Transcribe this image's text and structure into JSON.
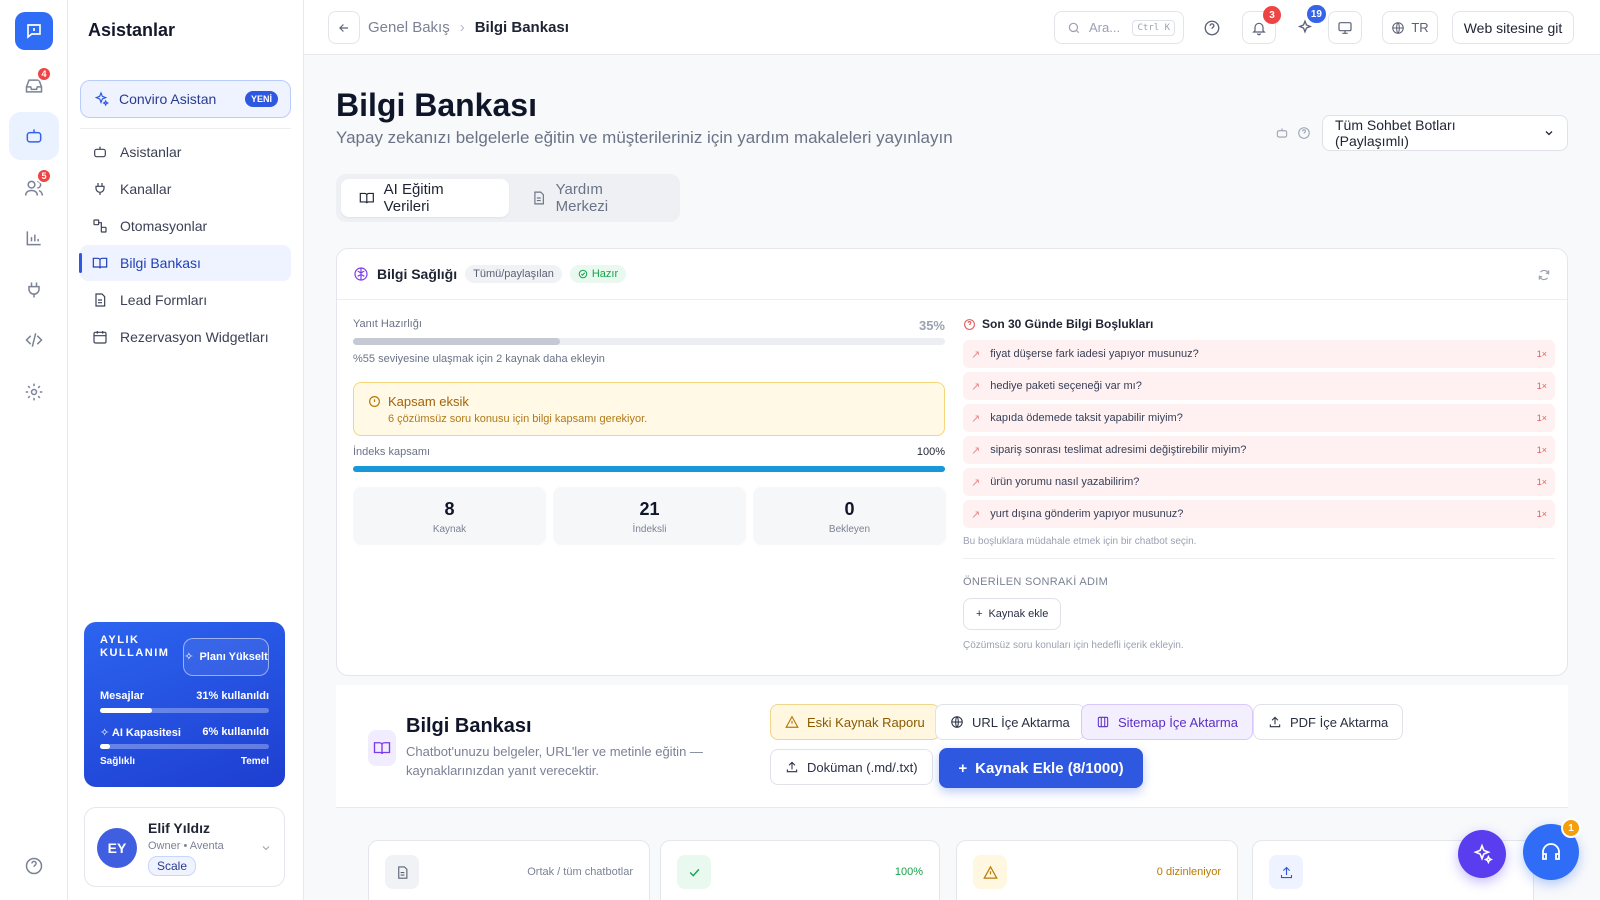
{
  "rail": {
    "badges": {
      "inbox": "4",
      "contacts": "5"
    }
  },
  "sidebar": {
    "title": "Asistanlar",
    "conviro": {
      "label": "Conviro Asistan",
      "badge": "YENİ"
    },
    "items": [
      {
        "label": "Asistanlar",
        "icon": "bot-icon"
      },
      {
        "label": "Kanallar",
        "icon": "plug-icon"
      },
      {
        "label": "Otomasyonlar",
        "icon": "workflow-icon"
      },
      {
        "label": "Bilgi Bankası",
        "icon": "book-icon",
        "active": true
      },
      {
        "label": "Lead Formları",
        "icon": "form-icon"
      },
      {
        "label": "Rezervasyon Widgetları",
        "icon": "calendar-icon"
      }
    ],
    "usage": {
      "title": "AYLIK KULLANIM",
      "upgrade": "Planı Yükselt",
      "messages_label": "Mesajlar",
      "messages_value": "31% kullanıldı",
      "messages_fraction": 0.31,
      "ai_label": "AI Kapasitesi",
      "ai_value": "6% kullanıldı",
      "ai_fraction": 0.06,
      "health_label": "Sağlıklı",
      "tier_label": "Temel"
    },
    "profile": {
      "initials": "EY",
      "name": "Elif Yıldız",
      "role": "Owner • Aventa",
      "plan": "Scale"
    }
  },
  "topbar": {
    "breadcrumb_parent": "Genel Bakış",
    "breadcrumb_current": "Bilgi Bankası",
    "search_placeholder": "Ara...",
    "search_shortcut": "Ctrl K",
    "notifications_count": "3",
    "ai_count": "19",
    "language": "TR",
    "website_button": "Web sitesine git"
  },
  "page": {
    "title": "Bilgi Bankası",
    "subtitle": "Yapay zekanızı belgelerle eğitin ve müşterileriniz için yardım makaleleri yayınlayın",
    "bot_select": "Tüm Sohbet Botları (Paylaşımlı)",
    "tabs": [
      {
        "label": "AI Eğitim Verileri",
        "active": true
      },
      {
        "label": "Yardım Merkezi",
        "active": false
      }
    ]
  },
  "health": {
    "title": "Bilgi Sağlığı",
    "scope_pill": "Tümü/paylaşılan",
    "status_pill": "Hazır",
    "readiness_label": "Yanıt Hazırlığı",
    "readiness_value": "35%",
    "readiness_fraction": 0.35,
    "readiness_hint": "%55 seviyesine ulaşmak için 2 kaynak daha ekleyin",
    "warning_title": "Kapsam eksik",
    "warning_text": "6 çözümsüz soru konusu için bilgi kapsamı gerekiyor.",
    "index_label": "İndeks kapsamı",
    "index_value": "100%",
    "index_fraction": 1.0,
    "stats": [
      {
        "value": "8",
        "label": "Kaynak"
      },
      {
        "value": "21",
        "label": "İndeksli"
      },
      {
        "value": "0",
        "label": "Bekleyen"
      }
    ],
    "gaps_title": "Son 30 Günde Bilgi Boşlukları",
    "gaps": [
      {
        "text": "fiyat düşerse fark iadesi yapıyor musunuz?",
        "count": "1×"
      },
      {
        "text": "hediye paketi seçeneği var mı?",
        "count": "1×"
      },
      {
        "text": "kapıda ödemede taksit yapabilir miyim?",
        "count": "1×"
      },
      {
        "text": "sipariş sonrası teslimat adresimi değiştirebilir miyim?",
        "count": "1×"
      },
      {
        "text": "ürün yorumu nasıl yazabilirim?",
        "count": "1×"
      },
      {
        "text": "yurt dışına gönderim yapıyor musunuz?",
        "count": "1×"
      }
    ],
    "gaps_hint": "Bu boşluklara müdahale etmek için bir chatbot seçin.",
    "next_step_title": "ÖNERİLEN SONRAKİ ADIM",
    "next_step_button": "Kaynak ekle",
    "next_step_hint": "Çözümsüz soru konuları için hedefli içerik ekleyin."
  },
  "kb": {
    "title": "Bilgi Bankası",
    "description": "Chatbot'unuzu belgeler, URL'ler ve metinle eğitin — kaynaklarınızdan yanıt verecektir.",
    "buttons": {
      "old_report": "Eski Kaynak Raporu",
      "url_import": "URL İçe Aktarma",
      "sitemap_import": "Sitemap İçe Aktarma",
      "pdf_import": "PDF İçe Aktarma",
      "doc": "Doküman (.md/.txt)",
      "add_source": "Kaynak Ekle (8/1000)"
    },
    "cards": [
      {
        "meta": "Ortak / tüm chatbotlar"
      },
      {
        "meta": "100%"
      },
      {
        "meta": "0 dizinleniyor"
      },
      {
        "meta": ""
      }
    ]
  },
  "support_badge": "1",
  "colors": {
    "accent": "#2f58e0",
    "warning": "#f3d67b",
    "danger": "#ef4444",
    "success": "#16a34a"
  }
}
